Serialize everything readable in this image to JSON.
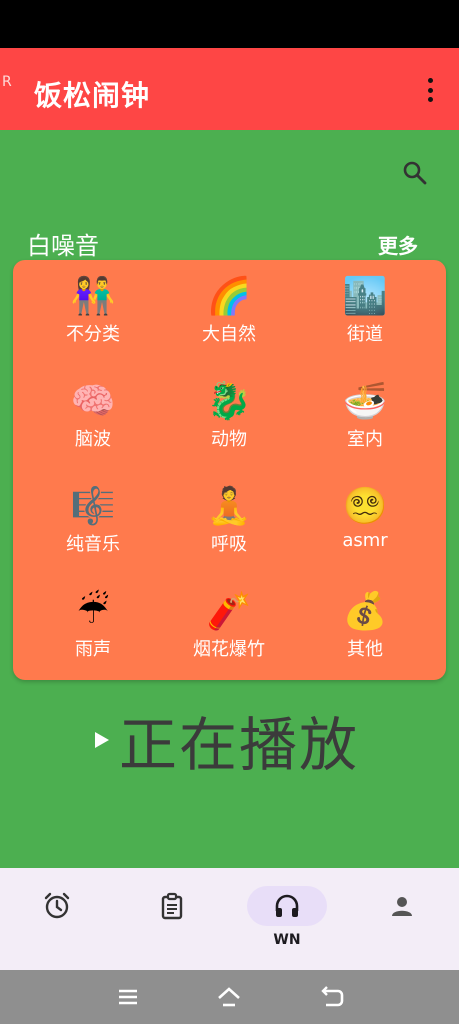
{
  "app": {
    "r_mark": "R",
    "title": "饭松闹钟"
  },
  "section": {
    "title": "白噪音",
    "more": "更多"
  },
  "categories": [
    {
      "emoji": "👫",
      "label": "不分类"
    },
    {
      "emoji": "🌈",
      "label": "大自然"
    },
    {
      "emoji": "🏙️",
      "label": "街道"
    },
    {
      "emoji": "🧠",
      "label": "脑波"
    },
    {
      "emoji": "🐉",
      "label": "动物"
    },
    {
      "emoji": "🍜",
      "label": "室内"
    },
    {
      "emoji": "🎼",
      "label": "纯音乐"
    },
    {
      "emoji": "🧘",
      "label": "呼吸"
    },
    {
      "emoji": "😵‍💫",
      "label": "asmr"
    },
    {
      "emoji": "☔",
      "label": "雨声"
    },
    {
      "emoji": "🧨",
      "label": "烟花爆竹"
    },
    {
      "emoji": "💰",
      "label": "其他"
    }
  ],
  "now_playing": "正在播放",
  "bottom_nav": {
    "items": [
      {
        "icon": "alarm-icon",
        "label": ""
      },
      {
        "icon": "clipboard-icon",
        "label": ""
      },
      {
        "icon": "headphones-icon",
        "label": "WN"
      },
      {
        "icon": "person-icon",
        "label": ""
      }
    ],
    "active_index": 2
  },
  "colors": {
    "app_bar": "#fe4645",
    "background": "#4caf50",
    "card": "#ff7a4d",
    "bottom_nav": "#f3edf7",
    "active_pill": "#e8def8"
  }
}
